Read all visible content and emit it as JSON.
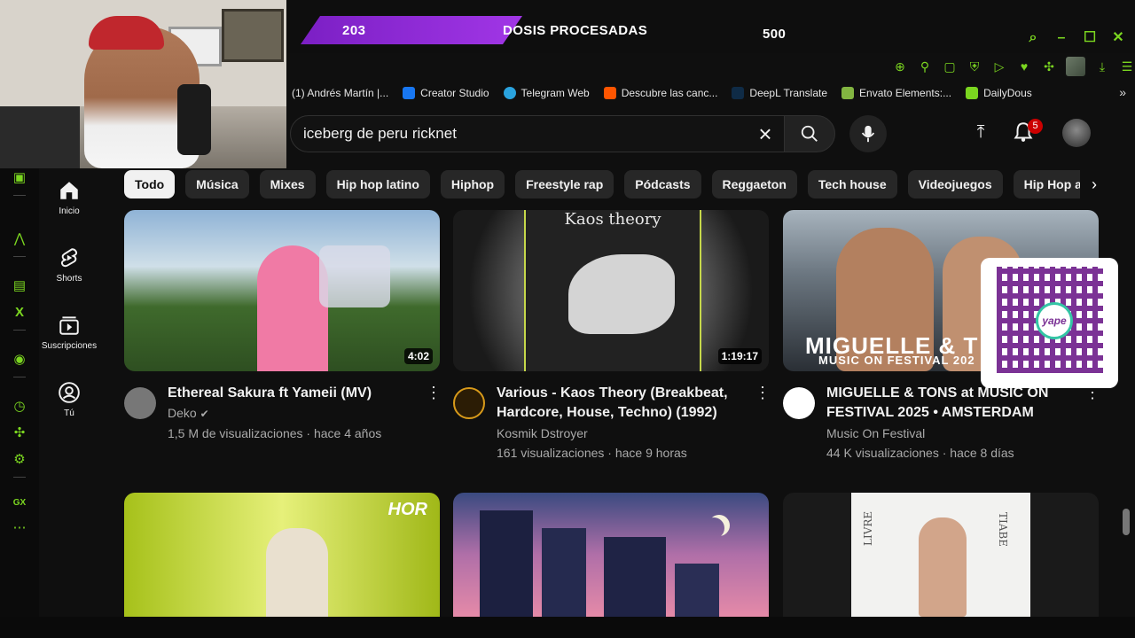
{
  "stream_bar": {
    "left_value": "203",
    "center_label": "DOSIS PROCESADAS",
    "right_value": "500",
    "accent_color": "#7bd620",
    "purple": "#a136e6"
  },
  "window_controls": [
    "search-icon",
    "minimize-icon",
    "maximize-icon",
    "close-icon"
  ],
  "bookmarks": [
    {
      "label": "(1) Andrés Martín |...",
      "color": "#333333"
    },
    {
      "label": "Creator Studio",
      "color": "#1877f2"
    },
    {
      "label": "Telegram Web",
      "color": "#2aa3df"
    },
    {
      "label": "Descubre las canc...",
      "color": "#ff5500"
    },
    {
      "label": "DeepL Translate",
      "color": "#0f2b46"
    },
    {
      "label": "Envato Elements:...",
      "color": "#82b541"
    },
    {
      "label": "DailyDous",
      "color": "#7bd620"
    }
  ],
  "search": {
    "query": "iceberg de peru ricknet"
  },
  "notifications": {
    "count": "5"
  },
  "sidebar": {
    "items": [
      {
        "label": "Inicio",
        "icon": "home-icon"
      },
      {
        "label": "Shorts",
        "icon": "shorts-icon"
      },
      {
        "label": "Suscripciones",
        "icon": "subscriptions-icon"
      },
      {
        "label": "Tú",
        "icon": "you-icon"
      }
    ]
  },
  "chips": [
    "Todo",
    "Música",
    "Mixes",
    "Hip hop latino",
    "Hiphop",
    "Freestyle rap",
    "Pódcasts",
    "Reggaeton",
    "Tech house",
    "Videojuegos",
    "Hip Hop alt"
  ],
  "videos": [
    {
      "title": "Ethereal Sakura ft Yameii (MV)",
      "channel": "Deko",
      "meta": "1,5 M de visualizaciones · hace 4 años",
      "duration": "4:02",
      "verified": true
    },
    {
      "title": "Various - Kaos Theory (Breakbeat, Hardcore, House, Techno) (1992)",
      "channel": "Kosmik Dstroyer",
      "meta": "161 visualizaciones · hace 9 horas",
      "duration": "1:19:17",
      "thumb_text": "Kaos theory"
    },
    {
      "title": "MIGUELLE & TONS at MUSIC ON FESTIVAL 2025 • AMSTERDAM",
      "channel": "Music On Festival",
      "meta": "44 K visualizaciones · hace 8 días",
      "thumb_text_1": "MIGUELLE & T",
      "thumb_text_2": "MUSIC ON FESTIVAL 202"
    }
  ],
  "row2": {
    "thumb1_text": "HOR",
    "thumb3_text_left": "LIVRE",
    "thumb3_text_right": "TIABE"
  },
  "qr_overlay": {
    "label": "yape"
  },
  "gx_rail": {
    "label": "GX"
  }
}
